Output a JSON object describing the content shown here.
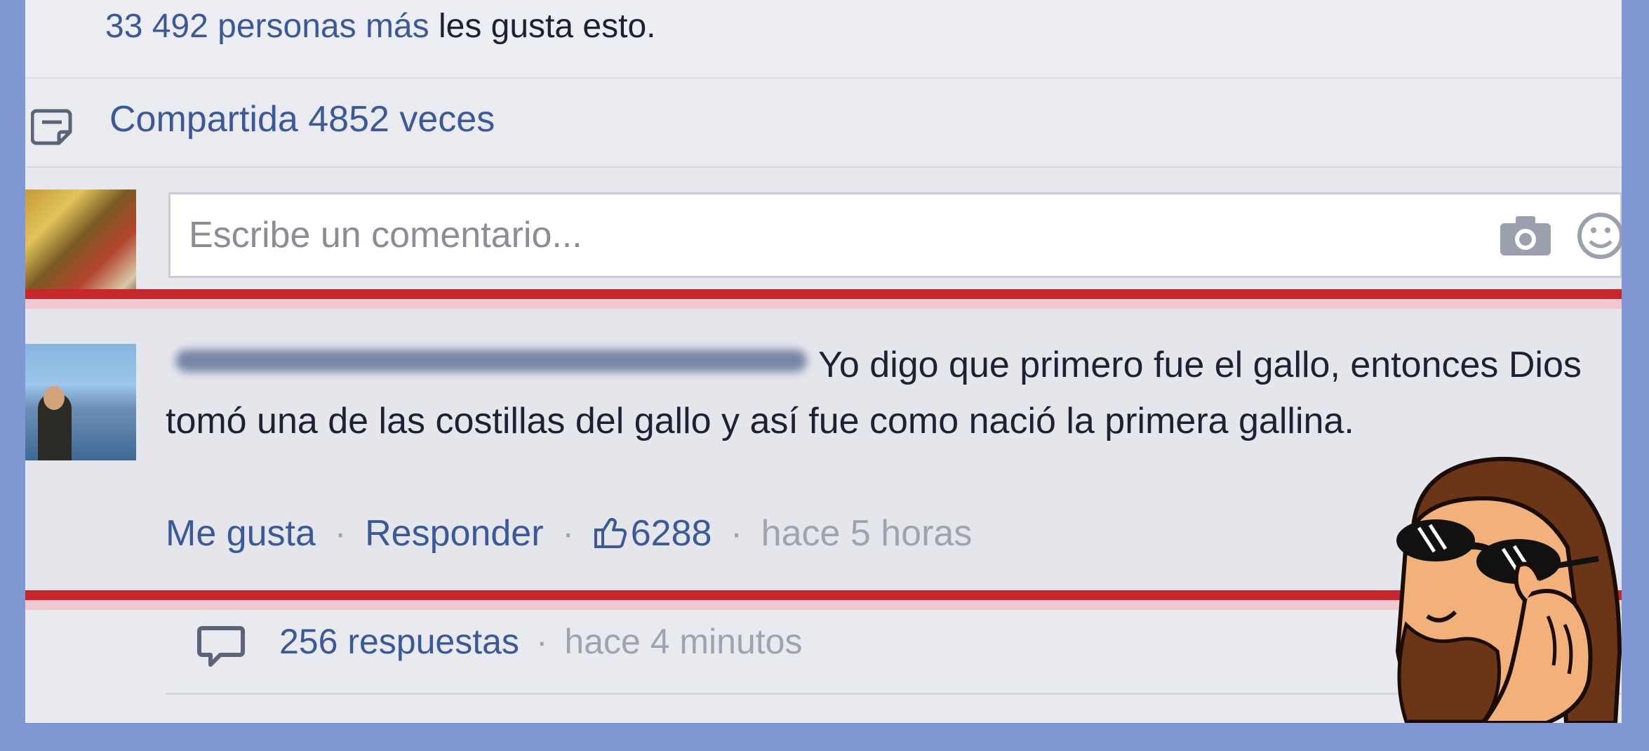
{
  "post": {
    "likes_text_prefix": "33 492 personas más",
    "likes_text_suffix": "les gusta esto.",
    "shares_text": "Compartida 4852 veces"
  },
  "composer": {
    "placeholder": "Escribe un comentario..."
  },
  "comment": {
    "text_line1": "Yo digo que primero fue el gallo, entonces",
    "text_rest": "Dios tomó una de las costillas del gallo y así fue como nació la primera gallina.",
    "like_label": "Me gusta",
    "reply_label": "Responder",
    "like_count": "6288",
    "time": "hace 5 horas",
    "separator": "·"
  },
  "replies": {
    "count_text": "256 respuestas",
    "time": "hace 4 minutos",
    "separator": "·"
  },
  "colors": {
    "link_blue": "#3b5998",
    "highlight_red": "#c7262c",
    "frame_blue": "#7f98d4"
  },
  "icons": {
    "share": "share-icon",
    "camera": "camera-icon",
    "smiley": "smiley-icon",
    "thumb": "thumbs-up-icon",
    "reply": "speech-bubble-icon"
  }
}
